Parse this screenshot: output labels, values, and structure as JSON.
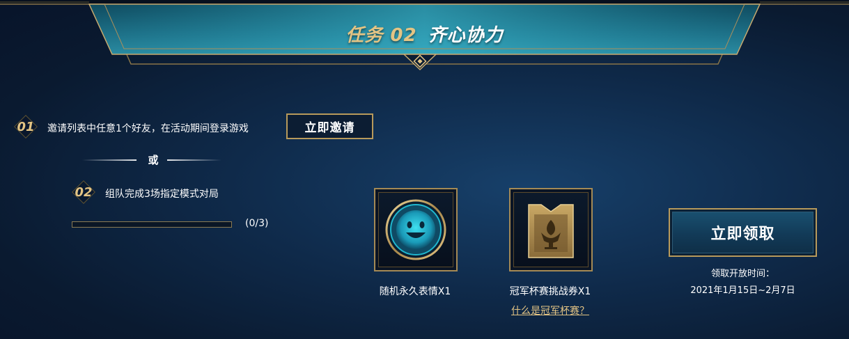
{
  "banner": {
    "task_tag": "任务 02",
    "task_name": "齐心协力"
  },
  "task1": {
    "number": "01",
    "description": "邀请列表中任意1个好友，在活动期间登录游戏",
    "button_label": "立即邀请"
  },
  "divider": {
    "label": "或"
  },
  "task2": {
    "number": "02",
    "description": "组队完成3场指定模式对局",
    "progress_text": "(0/3)",
    "progress_current": 0,
    "progress_total": 3
  },
  "rewards": [
    {
      "icon": "smile-emote-icon",
      "label": "随机永久表情X1"
    },
    {
      "icon": "champion-ticket-icon",
      "label": "冠军杯赛挑战券X1"
    }
  ],
  "champion_link": "什么是冠军杯赛？",
  "claim": {
    "button_label": "立即领取",
    "time_label": "领取开放时间：",
    "time_range": "2021年1月15日~2月7日"
  },
  "colors": {
    "gold": "#c8aa6e",
    "gold_text": "#e3c484",
    "teal": "#1d6f86",
    "background": "#0f2a4a"
  }
}
